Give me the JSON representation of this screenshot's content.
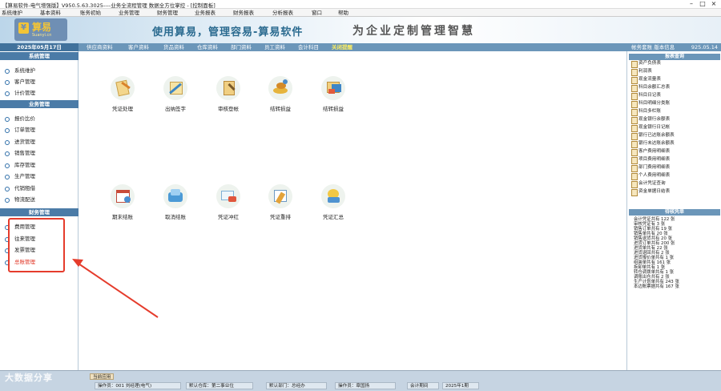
{
  "window": {
    "title": "【算易软件-电气增强版】V950.5.63.3025----业务全流程管理 数据全方位掌控 - [控制面板]",
    "controls": [
      "–",
      "□",
      "×"
    ]
  },
  "menu": [
    "系统维护",
    "基本资料",
    "账务初始",
    "业务管理",
    "财务管理",
    "业务报表",
    "财务报表",
    "分析报表",
    "窗口",
    "帮助"
  ],
  "banner": {
    "logo_name": "算易",
    "logo_sub": "Suanyi.cn",
    "slogan": "使用算易，管理容易-算易软件",
    "slogan2": "为企业定制管理智慧"
  },
  "topnav": {
    "date": "2025年05月17日",
    "links": [
      "供应商资料",
      "客户资料",
      "货品资料",
      "仓库资料",
      "部门资料",
      "员工资料",
      "会计科目",
      "关闭提醒"
    ],
    "active_index": 7,
    "right": "帐务套账  版本信息",
    "version": "925.05.14"
  },
  "sidebar": {
    "sections": [
      {
        "title": "系统管理",
        "items": [
          "系统维护",
          "客户管理",
          "计价管理"
        ]
      },
      {
        "title": "业务管理",
        "items": [
          "报价比价",
          "订单管理",
          "进货管理",
          "销售管理",
          "库存管理",
          "生产管理",
          "代销租借",
          "物流配送"
        ]
      },
      {
        "title": "财务管理",
        "items": [
          "费用管理",
          "往来管理",
          "发票管理",
          "总账管理"
        ]
      }
    ],
    "highlighted_item": "总账管理"
  },
  "main": {
    "row1": [
      "凭证处理",
      "出纳签字",
      "审核登帐",
      "结转损益",
      "结转损益"
    ],
    "row2": [
      "期末结账",
      "取消结账",
      "凭证冲红",
      "凭证重排",
      "凭证汇总"
    ]
  },
  "reports": {
    "title": "报表查询",
    "items": [
      "资产负债表",
      "利润表",
      "现金流量表",
      "科目余额汇总表",
      "科目日记表",
      "科目明细分类账",
      "科目多栏账",
      "现金银行余额表",
      "现金银行日记帐",
      "银行已达账余额表",
      "银行未达账余额表",
      "客户费用明细表",
      "项目费用明细表",
      "部门费用明细表",
      "个人费用明细表",
      "会计凭证查询",
      "资金单据日结表"
    ]
  },
  "todo": {
    "title": "待核凭单",
    "items": [
      "会计凭证共有 122 张",
      "审核凭证有 3 张",
      "销售订单共有 19 张",
      "销售单共有 20 张",
      "销售退货共有 20 张",
      "进货订单共有 200 张",
      "进货单共有 22 张",
      "进货退回共有 2 张",
      "进货报价单共有 1 张",
      "组装单共有 161 张",
      "拆卸单共有 1 张",
      "转仓调拨单共有 1 张",
      "调账出仓共有 2 张",
      "生产计划单共有 243 张",
      "本边账票据共有 167 张"
    ]
  },
  "status": {
    "tab": "当前应用",
    "cells": [
      "操作员：001 刘经理(电气)",
      "默认仓库：第二事业位",
      "默认部门：总经办",
      "操作员：章国扬",
      "会计期间",
      "2025年1期"
    ]
  },
  "watermark": "大数据分享",
  "colors": {
    "accent": "#4b7ba7",
    "highlight": "#e53c2c",
    "active_link": "#ffef60"
  }
}
